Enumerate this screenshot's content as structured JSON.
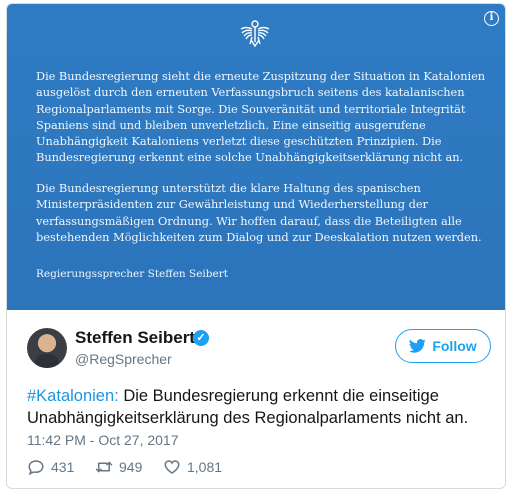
{
  "statement": {
    "paragraph1": "Die Bundesregierung sieht die erneute Zuspitzung der Situation in Katalonien ausgelöst durch den erneuten Verfassungsbruch seitens des katalanischen Regionalparlaments mit Sorge. Die Souveränität und territoriale Integrität Spaniens sind und bleiben unverletzlich. Eine einseitig ausgerufene Unabhängigkeit Kataloniens verletzt diese geschützten Prinzipien. Die Bundesregierung erkennt eine solche Unabhängigkeitserklärung nicht an.",
    "paragraph2": "Die Bundesregierung unterstützt die klare Haltung des spanischen Ministerpräsidenten zur Gewährleistung und Wiederherstellung der verfassungsmäßigen Ordnung. Wir hoffen darauf, dass die Beteiligten alle bestehenden Möglichkeiten zum Dialog und zur Deeskalation nutzen werden.",
    "signature": "Regierungssprecher Steffen Seibert",
    "info_symbol": "i",
    "background_color": "#2e79c1"
  },
  "author": {
    "display_name": "Steffen Seibert",
    "handle": "@RegSprecher",
    "verified": true
  },
  "follow_button": {
    "label": "Follow",
    "color": "#1da1f2"
  },
  "tweet": {
    "hashtag": "#Katalonien:",
    "text": " Die Bundesregierung erkennt die einseitige Unabhängigkeitserklärung des Regionalparlaments nicht an.",
    "timestamp": "11:42 PM - Oct 27, 2017"
  },
  "actions": {
    "replies": "431",
    "retweets": "949",
    "likes": "1,081"
  },
  "icons": [
    "eagle-emblem-icon",
    "info-icon",
    "verified-badge-icon",
    "twitter-bird-icon",
    "reply-icon",
    "retweet-icon",
    "like-icon"
  ]
}
